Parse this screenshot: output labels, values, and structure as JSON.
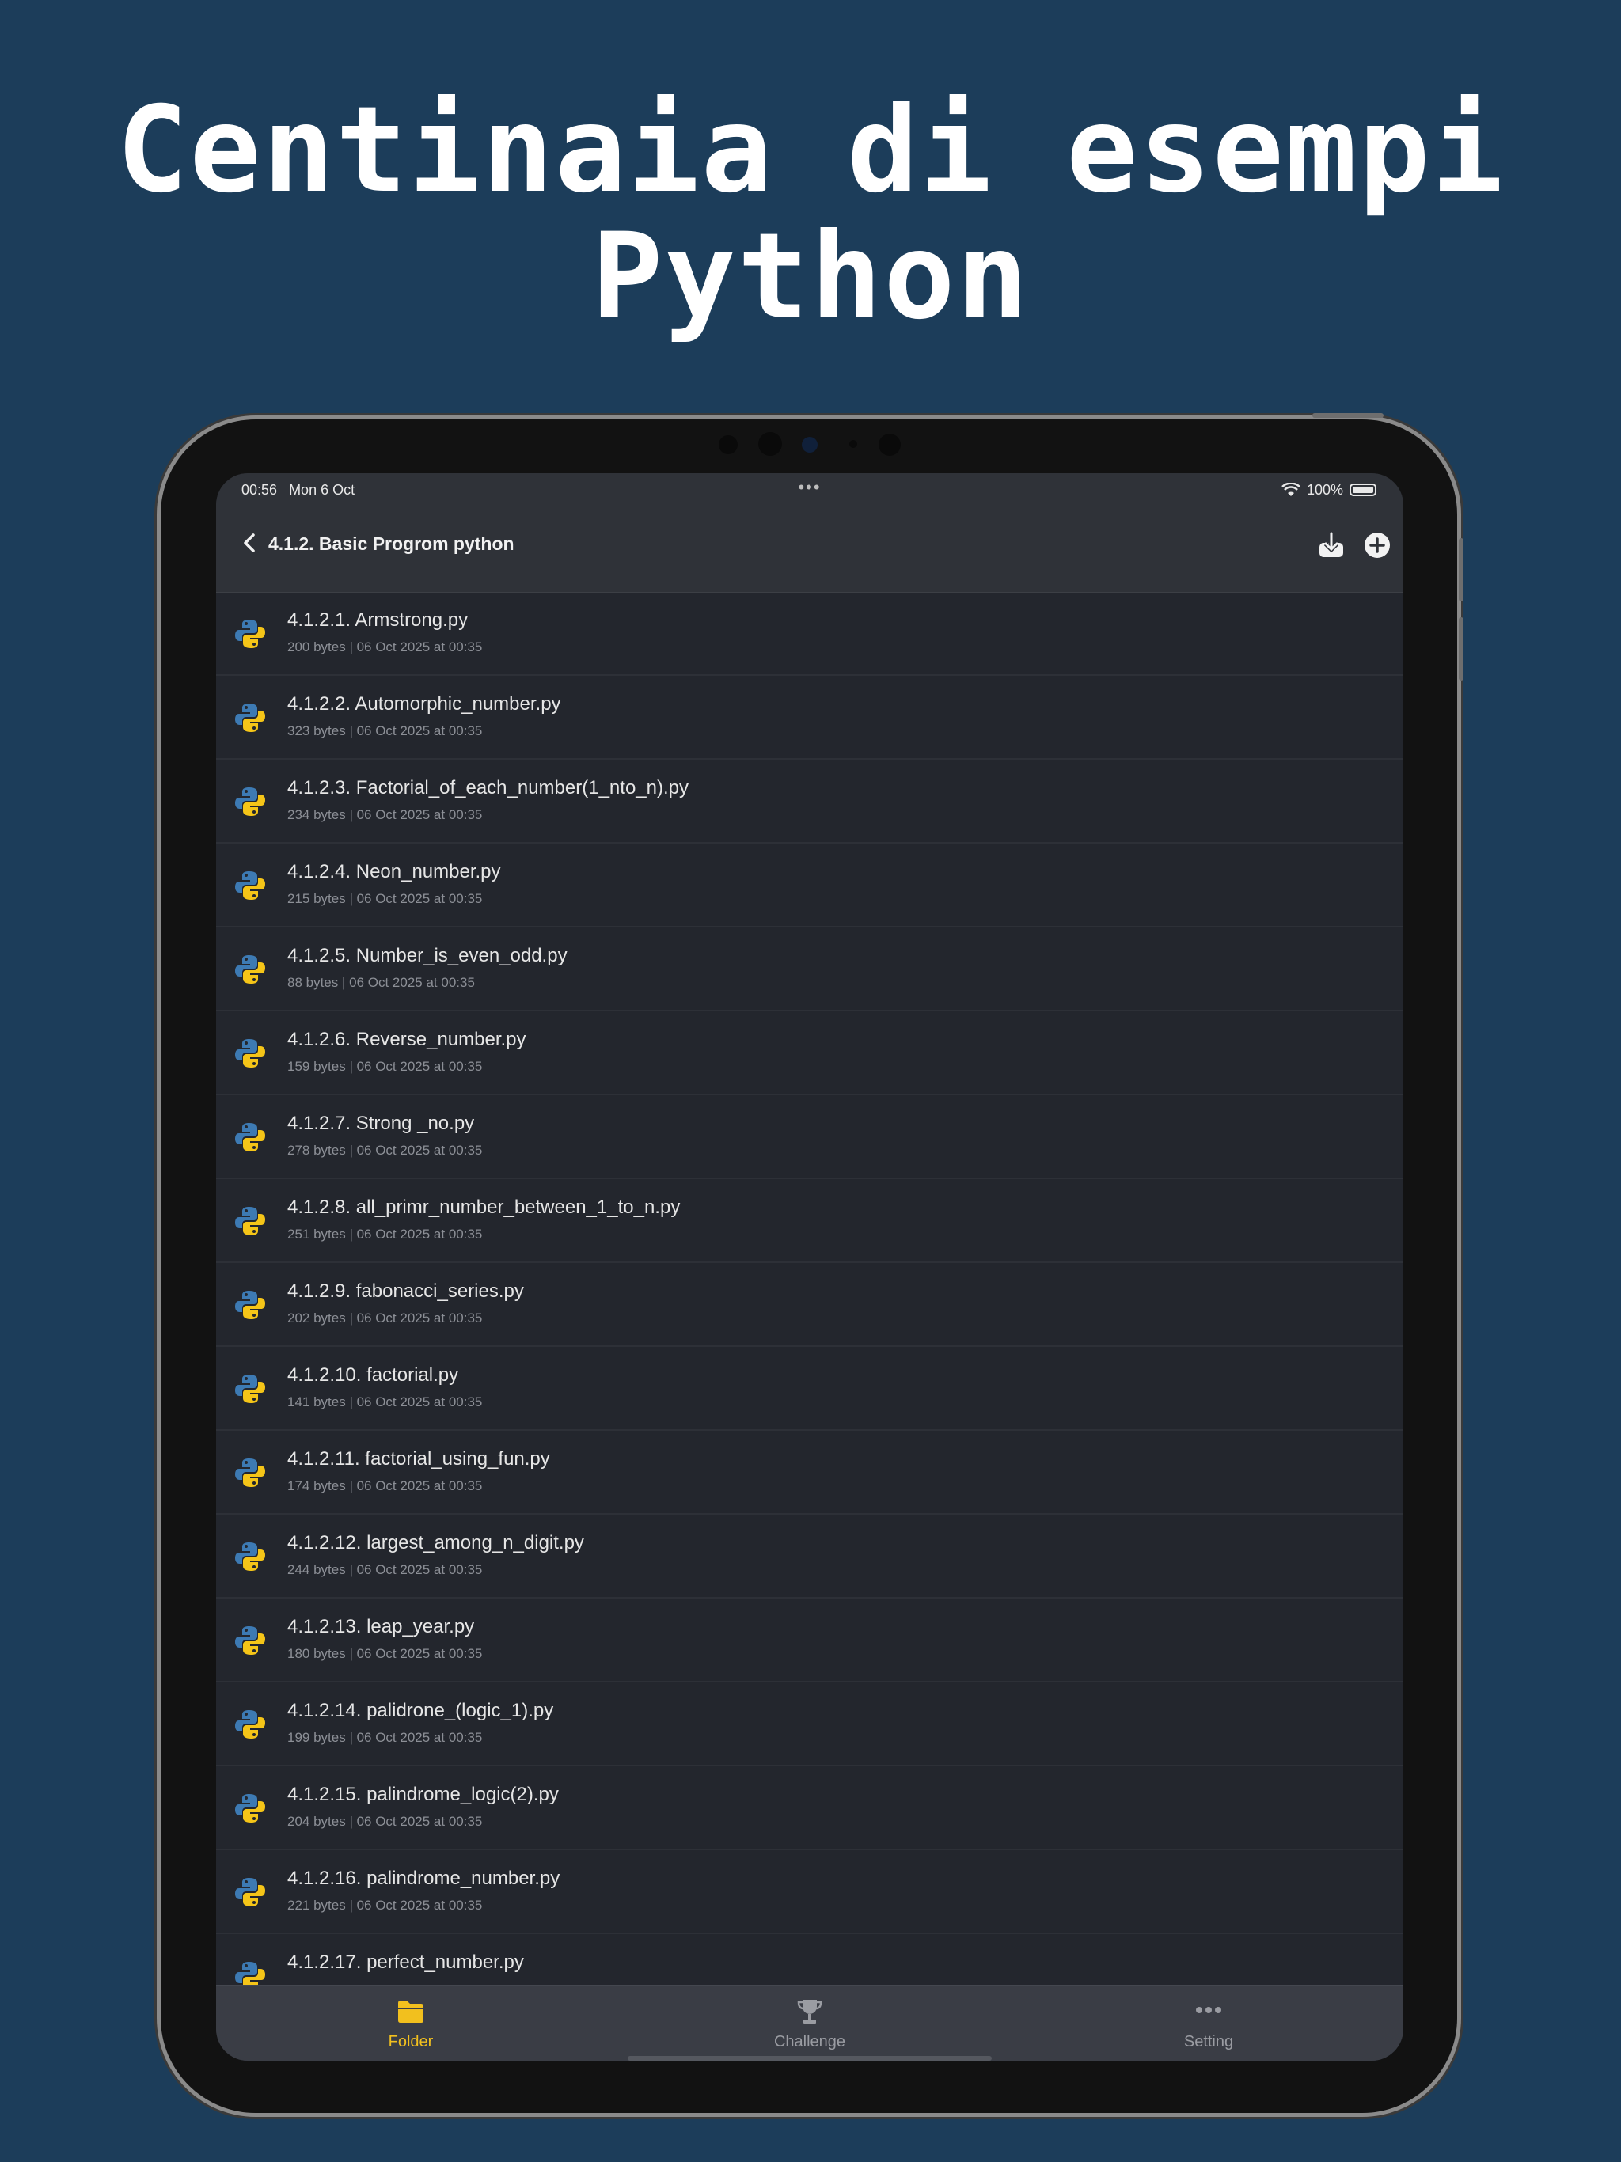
{
  "headline": [
    "Centinaia di esempi",
    "Python"
  ],
  "status": {
    "time": "00:56",
    "date": "Mon 6 Oct",
    "dots": "•••",
    "battery": "100%"
  },
  "nav": {
    "title": "4.1.2. Basic Progrom python",
    "back_icon": "chevron-left-icon",
    "download_icon": "download-icon",
    "add_icon": "plus-circle-icon"
  },
  "files": [
    {
      "name": "4.1.2.1. Armstrong.py",
      "meta": "200 bytes | 06 Oct 2025 at 00:35"
    },
    {
      "name": "4.1.2.2. Automorphic_number.py",
      "meta": "323 bytes | 06 Oct 2025 at 00:35"
    },
    {
      "name": "4.1.2.3. Factorial_of_each_number(1_nto_n).py",
      "meta": "234 bytes | 06 Oct 2025 at 00:35"
    },
    {
      "name": "4.1.2.4. Neon_number.py",
      "meta": "215 bytes | 06 Oct 2025 at 00:35"
    },
    {
      "name": "4.1.2.5. Number_is_even_odd.py",
      "meta": "88 bytes | 06 Oct 2025 at 00:35"
    },
    {
      "name": "4.1.2.6. Reverse_number.py",
      "meta": "159 bytes | 06 Oct 2025 at 00:35"
    },
    {
      "name": "4.1.2.7. Strong _no.py",
      "meta": "278 bytes | 06 Oct 2025 at 00:35"
    },
    {
      "name": "4.1.2.8. all_primr_number_between_1_to_n.py",
      "meta": "251 bytes | 06 Oct 2025 at 00:35"
    },
    {
      "name": "4.1.2.9. fabonacci_series.py",
      "meta": "202 bytes | 06 Oct 2025 at 00:35"
    },
    {
      "name": "4.1.2.10. factorial.py",
      "meta": "141 bytes | 06 Oct 2025 at 00:35"
    },
    {
      "name": "4.1.2.11. factorial_using_fun.py",
      "meta": "174 bytes | 06 Oct 2025 at 00:35"
    },
    {
      "name": "4.1.2.12. largest_among_n_digit.py",
      "meta": "244 bytes | 06 Oct 2025 at 00:35"
    },
    {
      "name": "4.1.2.13. leap_year.py",
      "meta": "180 bytes | 06 Oct 2025 at 00:35"
    },
    {
      "name": "4.1.2.14. palidrone_(logic_1).py",
      "meta": "199 bytes | 06 Oct 2025 at 00:35"
    },
    {
      "name": "4.1.2.15. palindrome_logic(2).py",
      "meta": "204 bytes | 06 Oct 2025 at 00:35"
    },
    {
      "name": "4.1.2.16. palindrome_number.py",
      "meta": "221 bytes | 06 Oct 2025 at 00:35"
    },
    {
      "name": "4.1.2.17. perfect_number.py",
      "meta": ""
    }
  ],
  "tabs": [
    {
      "label": "Folder",
      "icon": "folder-icon",
      "active": true
    },
    {
      "label": "Challenge",
      "icon": "trophy-icon",
      "active": false
    },
    {
      "label": "Setting",
      "icon": "more-dots-icon",
      "active": false
    }
  ],
  "colors": {
    "background": "#1c3d5a",
    "active_tab": "#f2c01e",
    "inactive_tab": "#9a9ca2",
    "python_blue": "#3d7ab3",
    "python_yellow": "#f5c518"
  }
}
